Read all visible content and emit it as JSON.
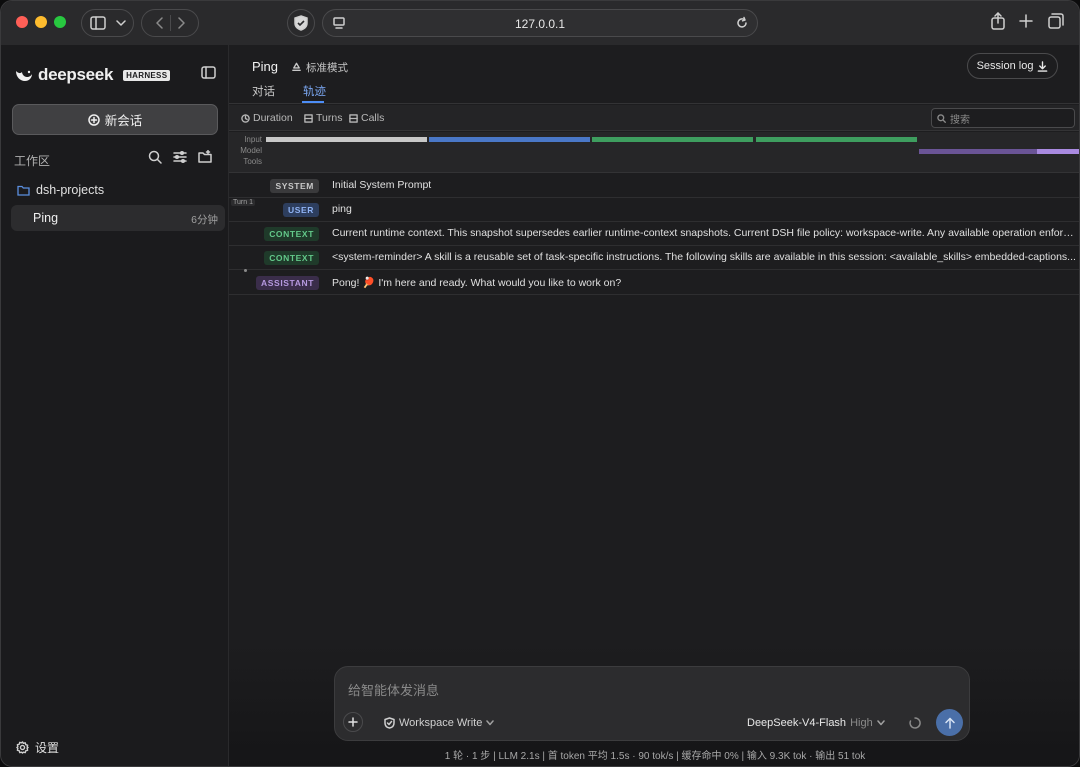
{
  "browser": {
    "url": "127.0.0.1"
  },
  "sidebar": {
    "logo_text": "deepseek",
    "logo_badge": "HARNESS",
    "new_chat_label": "新会话",
    "workspace_label": "工作区",
    "folder_name": "dsh-projects",
    "sessions": [
      {
        "name": "Ping",
        "ago": "6分钟"
      }
    ],
    "settings_label": "设置"
  },
  "header": {
    "title": "Ping",
    "mode_label": "标准模式",
    "tabs": [
      {
        "label": "对话",
        "active": false
      },
      {
        "label": "轨迹",
        "active": true
      }
    ],
    "session_log_label": "Session log"
  },
  "toolbar": {
    "duration_label": "Duration",
    "turns_label": "Turns",
    "calls_label": "Calls",
    "search_placeholder": "搜索"
  },
  "timeline": {
    "labels": [
      "Input",
      "Model",
      "Tools"
    ],
    "colors": {
      "system": "#c8c8c8",
      "user": "#4a78c8",
      "context": "#3e9e5f",
      "assistant": "#8a6ac8"
    }
  },
  "trace": {
    "turn_label": "Turn 1",
    "rows": [
      {
        "badge": "SYSTEM",
        "kind": "system",
        "text": "Initial System Prompt"
      },
      {
        "badge": "USER",
        "kind": "user",
        "text": "ping"
      },
      {
        "badge": "CONTEXT",
        "kind": "context",
        "text": "Current runtime context. This snapshot supersedes earlier runtime-context snapshots. Current DSH file policy: workspace-write. Any available operation enforc..."
      },
      {
        "badge": "CONTEXT",
        "kind": "context",
        "text": "<system-reminder> A skill is a reusable set of task-specific instructions. The following skills are available in this session: <available_skills> embedded-captions..."
      },
      {
        "badge": "ASSISTANT",
        "kind": "assistant",
        "text": "Pong! 🏓 I'm here and ready. What would you like to work on?"
      }
    ]
  },
  "composer": {
    "placeholder": "给智能体发消息",
    "permission_label": "Workspace Write",
    "model_name": "DeepSeek-V4-Flash",
    "model_level": "High"
  },
  "status_bar": "1 轮 · 1 步   |   LLM 2.1s   |   首 token 平均 1.5s · 90 tok/s   |   缓存命中 0%   |   输入 9.3K tok · 输出 51 tok"
}
